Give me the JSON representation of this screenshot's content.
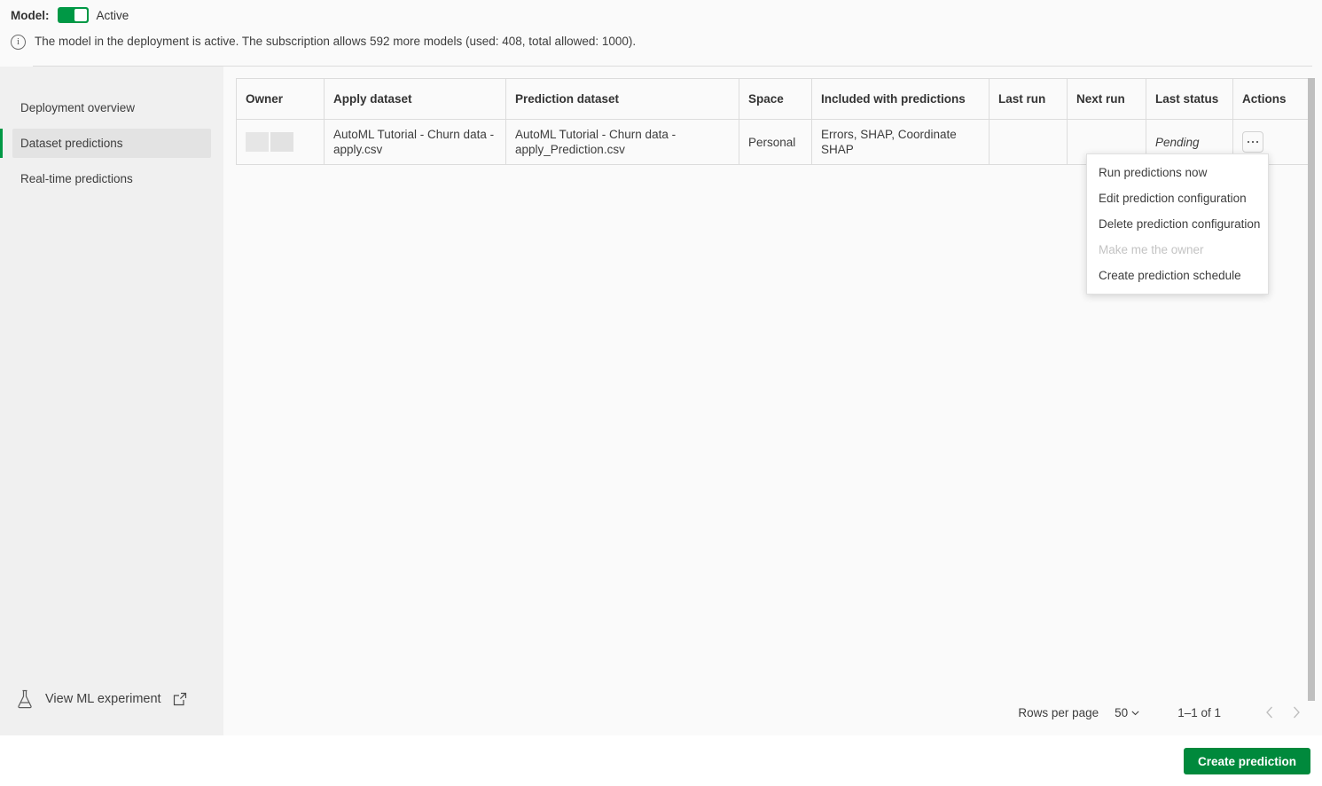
{
  "topbar": {
    "model_label": "Model:",
    "toggle_state": "on",
    "model_state": "Active",
    "info_icon": "info-circle-icon",
    "info_text": "The model in the deployment is active. The subscription allows 592 more models (used: 408, total allowed: 1000)."
  },
  "sidebar": {
    "items": [
      {
        "label": "Deployment overview",
        "selected": false
      },
      {
        "label": "Dataset predictions",
        "selected": true
      },
      {
        "label": "Real-time predictions",
        "selected": false
      }
    ],
    "ml_experiment": {
      "icon": "flask-icon",
      "label": "View ML experiment",
      "external_icon": "external-link-icon"
    }
  },
  "table": {
    "columns": [
      "Owner",
      "Apply dataset",
      "Prediction dataset",
      "Space",
      "Included with predictions",
      "Last run",
      "Next run",
      "Last status",
      "Actions"
    ],
    "rows": [
      {
        "owner": "",
        "apply_dataset": "AutoML Tutorial - Churn data - apply.csv",
        "prediction_dataset": "AutoML Tutorial - Churn data - apply_Prediction.csv",
        "space": "Personal",
        "included_with_predictions": "Errors, SHAP, Coordinate SHAP",
        "last_run": "",
        "next_run": "",
        "last_status": "Pending",
        "actions_icon": "kebab-menu-icon"
      }
    ]
  },
  "context_menu": {
    "items": [
      {
        "label": "Run predictions now",
        "disabled": false
      },
      {
        "label": "Edit prediction configuration",
        "disabled": false
      },
      {
        "label": "Delete prediction configuration",
        "disabled": false
      },
      {
        "label": "Make me the owner",
        "disabled": true
      },
      {
        "label": "Create prediction schedule",
        "disabled": false
      }
    ]
  },
  "pagination": {
    "rows_per_page_label": "Rows per page",
    "rows_per_page_value": "50",
    "range": "1–1 of 1",
    "prev_icon": "chevron-left-icon",
    "next_icon": "chevron-right-icon"
  },
  "footer": {
    "create_button": "Create prediction"
  },
  "colors": {
    "accent_green": "#009845",
    "button_green": "#00893c",
    "sidebar_bg": "#f0f0f0",
    "main_bg": "#fafafa",
    "border": "#dcdcdc"
  }
}
